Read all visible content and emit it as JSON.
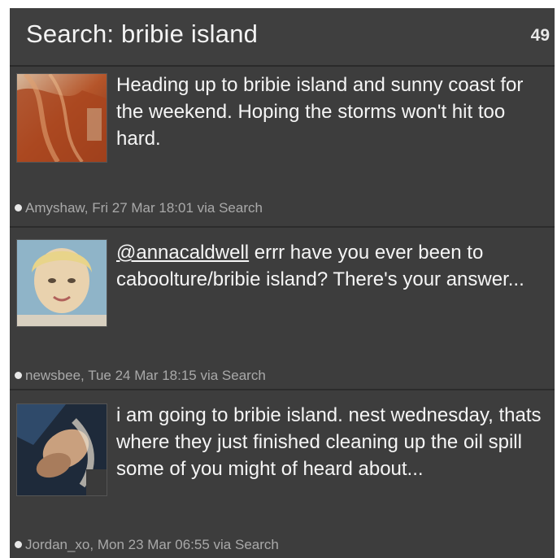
{
  "header": {
    "title": "Search: bribie island",
    "count": "49"
  },
  "tweets": [
    {
      "avatar_icon": "user-avatar-red-hair",
      "text": "Heading up to bribie island and sunny coast for the weekend. Hoping the storms won't hit too hard.",
      "meta": "Amyshaw, Fri 27 Mar 18:01 via Search"
    },
    {
      "avatar_icon": "user-avatar-blonde",
      "mention": "@annacaldwell",
      "text": " errr have you ever been to caboolture/bribie island? There's your answer...",
      "meta": "newsbee, Tue 24 Mar 18:15 via Search"
    },
    {
      "avatar_icon": "user-avatar-photo",
      "text": "i am going to bribie island. nest wednesday, thats where they just finished cleaning up the oil spill some of you might of heard about...",
      "meta": "Jordan_xo, Mon 23 Mar 06:55 via Search"
    }
  ],
  "colors": {
    "panel_bg": "#3b3b3b",
    "text": "#f5f5f5",
    "meta_text": "#a9a9a9"
  }
}
